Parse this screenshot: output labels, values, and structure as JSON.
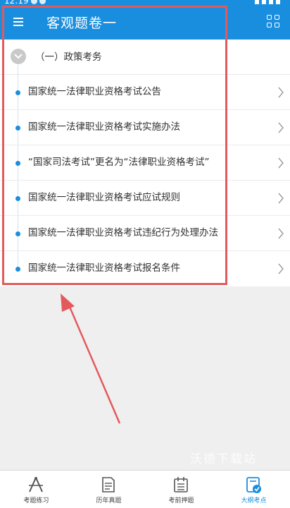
{
  "status_bar": {
    "time": "12:19"
  },
  "header": {
    "title": "客观题卷一"
  },
  "section": {
    "title": "（一）政策考务"
  },
  "items": [
    {
      "label": "国家统一法律职业资格考试公告"
    },
    {
      "label": "国家统一法律职业资格考试实施办法"
    },
    {
      "label": "“国家司法考试”更名为“法律职业资格考试”"
    },
    {
      "label": "国家统一法律职业资格考试应试规则"
    },
    {
      "label": "国家统一法律职业资格考试违纪行为处理办法"
    },
    {
      "label": "国家统一法律职业资格考试报名条件"
    }
  ],
  "watermark": "沃德下载站",
  "tabs": [
    {
      "label": "考题练习",
      "icon": "compass-ruler-icon"
    },
    {
      "label": "历年真题",
      "icon": "document-icon"
    },
    {
      "label": "考前押题",
      "icon": "notepad-icon"
    },
    {
      "label": "大纲考点",
      "icon": "outline-check-icon",
      "active": true
    }
  ],
  "colors": {
    "primary": "#1a8ede",
    "annotation": "#e35a5c",
    "background": "#efeff0"
  }
}
